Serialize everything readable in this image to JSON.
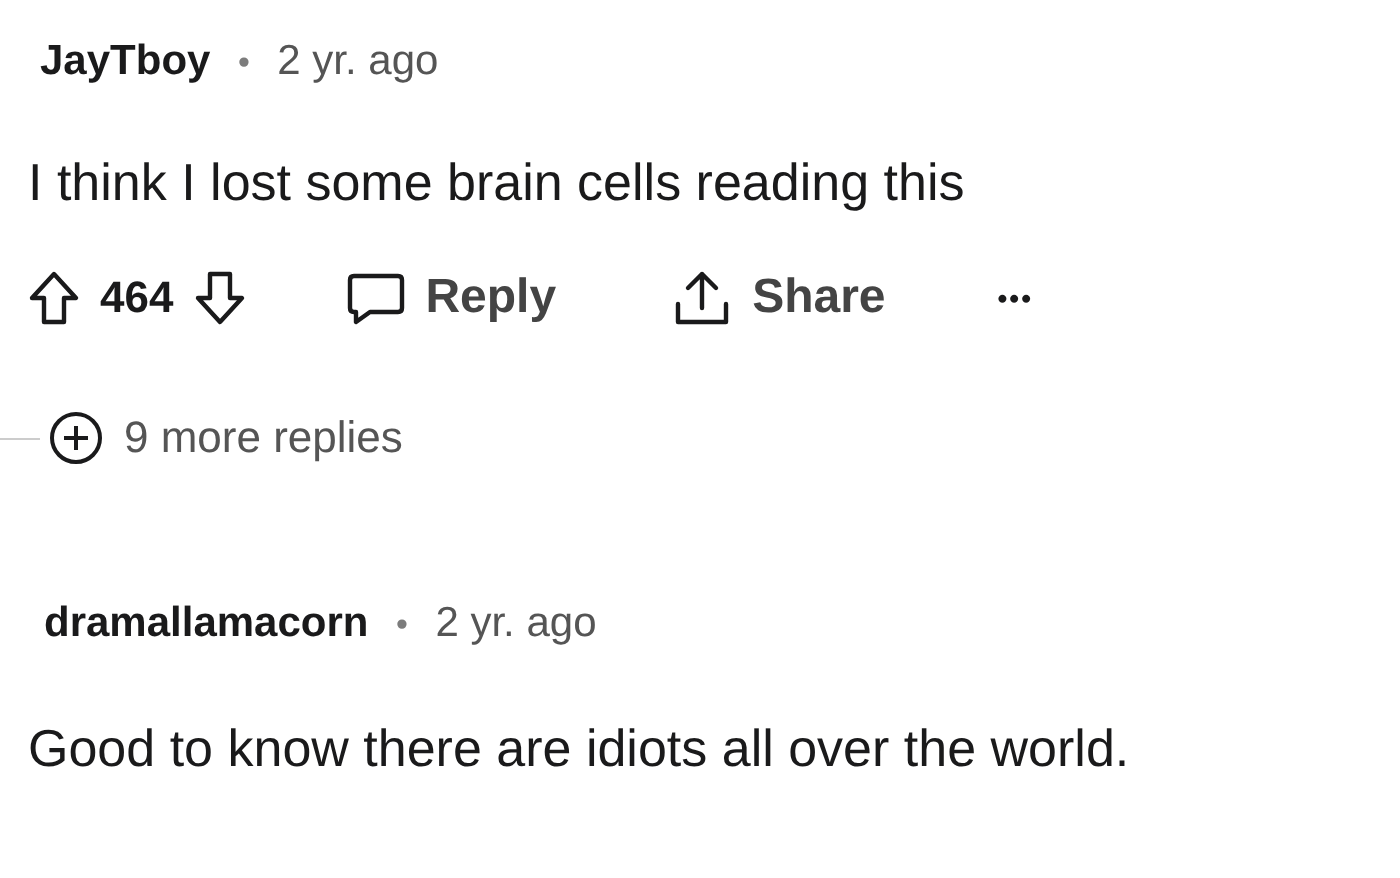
{
  "comments": [
    {
      "author": "JayTboy",
      "separator": "•",
      "time": "2 yr. ago",
      "body": "I think I lost some brain cells reading this",
      "score": "464",
      "actions": [
        {
          "kind": "reply",
          "label": "Reply"
        },
        {
          "kind": "share",
          "label": "Share"
        },
        {
          "kind": "more",
          "label": "•••"
        }
      ],
      "more_replies": "9 more replies"
    },
    {
      "author": "dramallamacorn",
      "separator": "•",
      "time": "2 yr. ago",
      "body": "Good to know there are idiots all over the world."
    }
  ]
}
